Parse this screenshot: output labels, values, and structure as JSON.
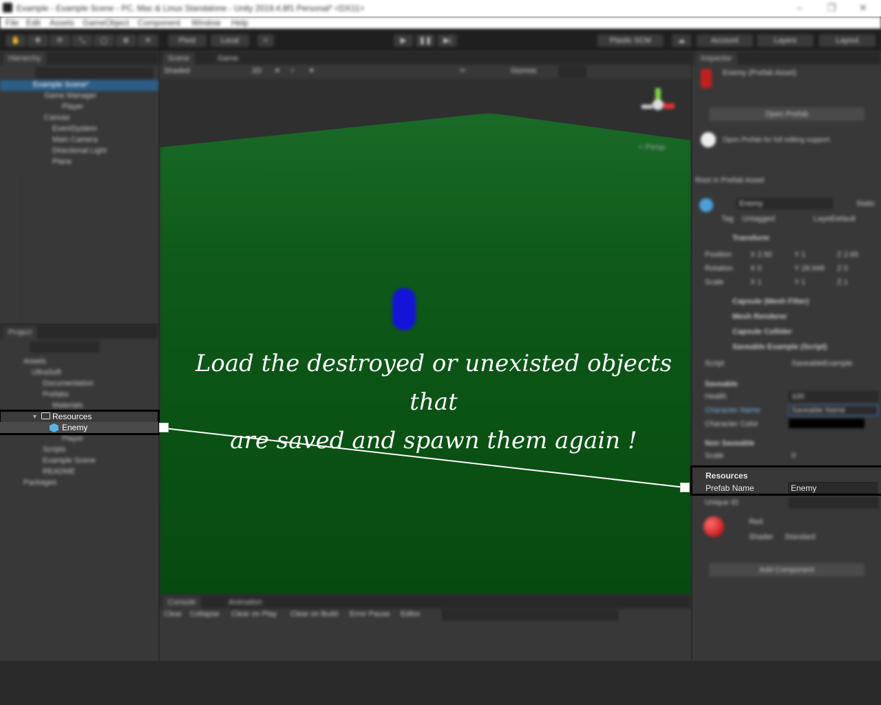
{
  "window": {
    "title": "Example - Example Scene - PC, Mac & Linux Standalone - Unity 2019.4.8f1 Personal* <DX11>"
  },
  "menu": [
    "File",
    "Edit",
    "Assets",
    "GameObject",
    "Component",
    "Window",
    "Help"
  ],
  "toolbar": {
    "pivot": "Pivot",
    "local": "Local",
    "collab": "Plastic SCM",
    "account": "Account",
    "layers": "Layers",
    "layout": "Layout"
  },
  "hierarchy": {
    "tab": "Hierarchy",
    "scene": "Example Scene*",
    "items": [
      "Game Manager",
      "Player",
      "Canvas",
      "EventSystem",
      "Main Camera",
      "Directional Light",
      "Plane"
    ]
  },
  "project": {
    "tab": "Project",
    "items": [
      "Assets",
      "UltraSoft",
      "Documentation",
      "Prefabs",
      "Materials",
      "Scripts",
      "Example Scene",
      "README",
      "Packages",
      "Player"
    ],
    "highlighted_folder": "Resources",
    "highlighted_asset": "Enemy"
  },
  "scene": {
    "tabs": [
      "Scene",
      "Game"
    ],
    "shading": "Shaded",
    "mode": "2D",
    "gizmos": "Gizmos",
    "persp": "< Persp"
  },
  "console": {
    "tabs": [
      "Console",
      "Animation"
    ],
    "buttons": [
      "Clear",
      "Collapse",
      "Clear on Play",
      "Clear on Build",
      "Error Pause",
      "Editor"
    ]
  },
  "inspector": {
    "tab": "Inspector",
    "object_name": "Enemy (Prefab Asset)",
    "open_prefab": "Open Prefab",
    "info": "Open Prefab for full editing support.",
    "root_label": "Root in Prefab Asset",
    "go_name": "Enemy",
    "static": "Static",
    "tag_label": "Tag",
    "tag_value": "Untagged",
    "layer_label": "Layer",
    "layer_value": "Default",
    "transform": "Transform",
    "position": "Position",
    "rotation": "Rotation",
    "scale": "Scale",
    "pos": [
      "X 2.50",
      "Y 1",
      "Z 2.65"
    ],
    "rot": [
      "X 0",
      "Y 28.948",
      "Z 0"
    ],
    "scl": [
      "X 1",
      "Y 1",
      "Z 1"
    ],
    "components": [
      "Capsule (Mesh Filter)",
      "Mesh Renderer",
      "Capsule Collider",
      "Saveable Example (Script)"
    ],
    "script_label": "Script",
    "script_value": "SaveableExample",
    "saveable": "Saveable",
    "health": "Health",
    "health_value": "100",
    "character_name": "Character Name",
    "character_name_value": "Saveable Name",
    "character_color": "Character Color",
    "non_saveable": "Non Saveable",
    "scale_field": "Scale",
    "scale_field_value": "0",
    "resources_header": "Resources",
    "prefab_name_label": "Prefab Name",
    "prefab_name_value": "Enemy",
    "unique_id": "Unique ID",
    "material": "Red",
    "shader_label": "Shader",
    "shader_value": "Standard",
    "add_component": "Add Component"
  },
  "annotation": {
    "line1": "Load the destroyed or unexisted objects that",
    "line2": "are saved and spawn them again !"
  },
  "colors": {
    "panel": "#383838",
    "highlight_box": "#000000",
    "leader_line": "#ffffff",
    "capsule": "#1414d8",
    "plane": "#0f5a1a"
  }
}
